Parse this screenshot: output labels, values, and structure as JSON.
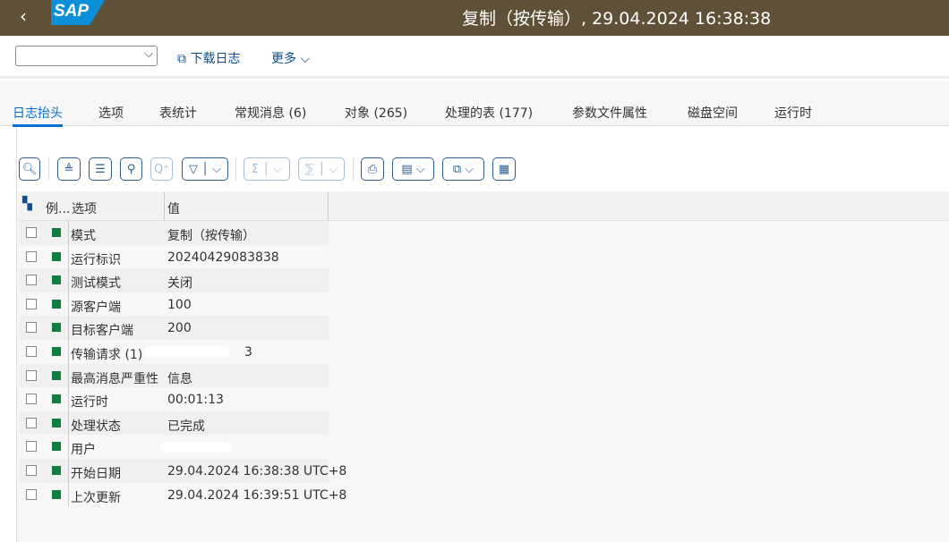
{
  "header": {
    "back": "‹",
    "logo": "SAP",
    "title": "复制（按传输）, 29.04.2024 16:38:38"
  },
  "toolbar": {
    "select_value": "",
    "download": "下载日志",
    "more": "更多"
  },
  "tabs": [
    "日志抬头",
    "选项",
    "表统计",
    "常规消息 (6)",
    "对象 (265)",
    "处理的表 (177)",
    "参数文件属性",
    "磁盘空间",
    "运行时"
  ],
  "grid": {
    "col_legend": "例...",
    "col_option": "选项",
    "col_value": "值",
    "rows": [
      {
        "option": "模式",
        "value": "复制（按传输）"
      },
      {
        "option": "运行标识",
        "value": "20240429083838"
      },
      {
        "option": "测试模式",
        "value": "关闭"
      },
      {
        "option": "源客户端",
        "value": "100"
      },
      {
        "option": "目标客户端",
        "value": "200"
      },
      {
        "option": "传输请求 (1)",
        "value": "3",
        "redacted": true
      },
      {
        "option": "最高消息严重性",
        "value": "信息"
      },
      {
        "option": "运行时",
        "value": "00:01:13"
      },
      {
        "option": "处理状态",
        "value": "已完成"
      },
      {
        "option": "用户",
        "value": "",
        "redacted": true
      },
      {
        "option": "开始日期",
        "value": "29.04.2024 16:38:38 UTC+8"
      },
      {
        "option": "上次更新",
        "value": "29.04.2024 16:39:51 UTC+8"
      }
    ]
  },
  "colors": {
    "header": "#5f5138",
    "status_green": "#107e3e",
    "accent": "#0a6ed1"
  }
}
